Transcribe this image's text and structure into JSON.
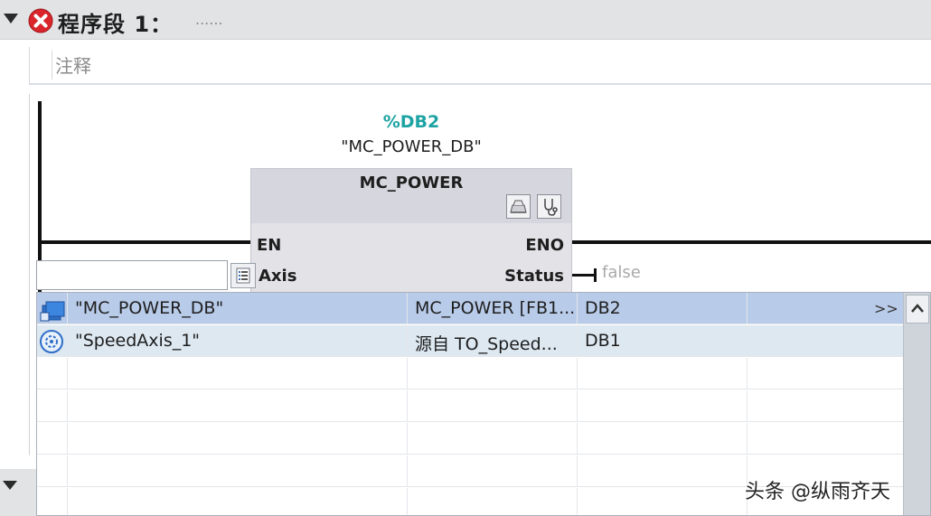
{
  "network": {
    "title": "程序段 1：",
    "dots": "......",
    "comment": "注释"
  },
  "block": {
    "db_address": "%DB2",
    "db_name": "\"MC_POWER_DB\"",
    "fb_name": "MC_POWER",
    "pins": {
      "en": "EN",
      "eno": "ENO",
      "axis": "Axis",
      "status": "Status"
    },
    "status_value": "false"
  },
  "autocomplete": {
    "input_value": "",
    "rows": [
      {
        "icon": "db-icon",
        "name": "\"MC_POWER_DB\"",
        "type": "MC_POWER [FB1...",
        "db": "DB2",
        "more": ">>"
      },
      {
        "icon": "technology-object-icon",
        "name": "\"SpeedAxis_1\"",
        "type": "源自 TO_Speed...",
        "db": "DB1",
        "more": ""
      }
    ]
  },
  "watermark": "头条 @纵雨齐天",
  "colors": {
    "db_address": "#1ea3a3",
    "selected_row": "#b8cbe9",
    "alt_row": "#dde8f1",
    "error": "#d9252b"
  }
}
